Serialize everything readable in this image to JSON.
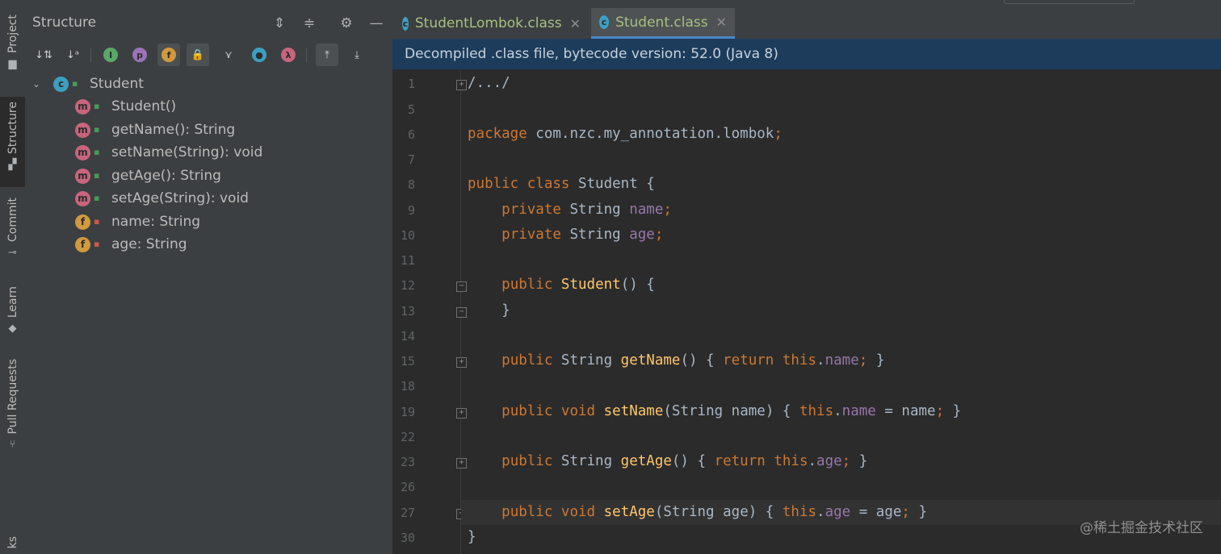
{
  "tool_strip": {
    "tabs": [
      {
        "label": "Project",
        "icon": "folder-icon"
      },
      {
        "label": "Structure",
        "icon": "structure-icon"
      },
      {
        "label": "Commit",
        "icon": "commit-icon"
      },
      {
        "label": "Learn",
        "icon": "learn-icon"
      },
      {
        "label": "Pull Requests",
        "icon": "pull-request-icon"
      },
      {
        "label": "ks",
        "icon": "bookmarks-icon"
      }
    ]
  },
  "structure": {
    "title": "Structure",
    "tree": {
      "root": {
        "label": "Student",
        "kind_badge": "c"
      },
      "members": [
        {
          "badge": "m",
          "visibility": "public",
          "label": "Student()"
        },
        {
          "badge": "m",
          "visibility": "public",
          "label": "getName(): String"
        },
        {
          "badge": "m",
          "visibility": "public",
          "label": "setName(String): void"
        },
        {
          "badge": "m",
          "visibility": "public",
          "label": "getAge(): String"
        },
        {
          "badge": "m",
          "visibility": "public",
          "label": "setAge(String): void"
        },
        {
          "badge": "f",
          "visibility": "private",
          "label": "name: String"
        },
        {
          "badge": "f",
          "visibility": "private",
          "label": "age: String"
        }
      ]
    }
  },
  "editor": {
    "tabs": [
      {
        "label": "StudentLombok.class",
        "icon_letter": "c",
        "active": false
      },
      {
        "label": "Student.class",
        "icon_letter": "c",
        "active": true
      }
    ],
    "banner": "Decompiled .class file, bytecode version: 52.0 (Java 8)",
    "line_numbers": [
      "1",
      "5",
      "6",
      "7",
      "8",
      "9",
      "10",
      "11",
      "12",
      "13",
      "14",
      "15",
      "18",
      "19",
      "22",
      "23",
      "26",
      "27",
      "30"
    ],
    "code_lines": [
      "/.../",
      "",
      "package com.nzc.my_annotation.lombok;",
      "",
      "public class Student {",
      "    private String name;",
      "    private String age;",
      "",
      "    public Student() {",
      "    }",
      "",
      "    public String getName() { return this.name; }",
      "",
      "    public void setName(String name) { this.name = name; }",
      "",
      "    public String getAge() { return this.age; }",
      "",
      "    public void setAge(String age) { this.age = age; }",
      "}"
    ]
  },
  "watermark": "@稀土掘金技术社区",
  "colors": {
    "keyword": "#cc7832",
    "method": "#ffc66d",
    "field": "#9876aa",
    "banner_bg": "#1d3c5c",
    "panel_bg": "#3c3f41",
    "editor_bg": "#2b2b2b"
  }
}
